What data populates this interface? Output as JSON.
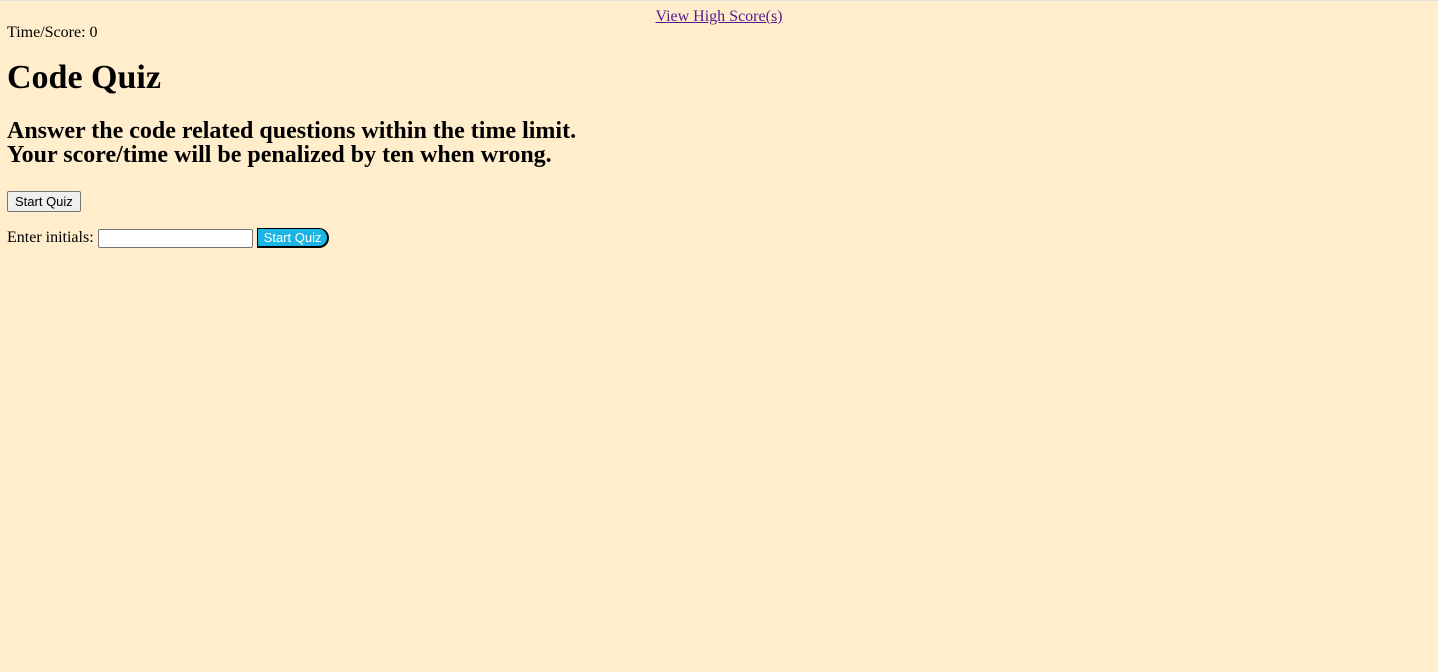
{
  "header": {
    "high_scores_link": "View High Score(s)",
    "timer_label": "Time/Score: ",
    "timer_value": "0"
  },
  "main": {
    "title": "Code Quiz",
    "subtitle_line1": "Answer the code related questions within the time limit.",
    "subtitle_line2": "Your score/time will be penalized by ten when wrong.",
    "start_button": "Start Quiz"
  },
  "initials_form": {
    "label": "Enter initials:",
    "input_value": "",
    "submit_button": "Start Quiz"
  },
  "colors": {
    "background": "#FFEDCC",
    "link": "#551A8B",
    "submit_button_bg": "#1AB4E5"
  }
}
